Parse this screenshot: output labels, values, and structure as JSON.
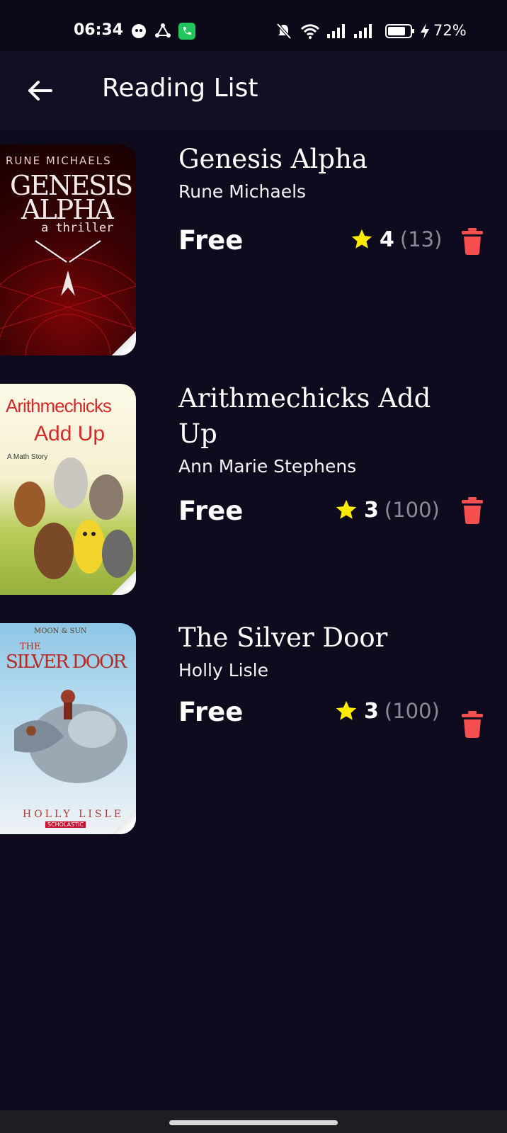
{
  "status_bar": {
    "time": "06:34",
    "battery": "72%"
  },
  "app_bar": {
    "title": "Reading List"
  },
  "books": [
    {
      "title": "Genesis Alpha",
      "author": "Rune Michaels",
      "price": "Free",
      "rating": "4",
      "rating_count": "(13)",
      "cover": {
        "author_text": "RUNE MICHAELS",
        "title_line1": "GENESIS",
        "title_line2": "ALPHA",
        "tagline": "a thriller"
      }
    },
    {
      "title": "Arithmechicks Add Up",
      "author": "Ann Marie Stephens",
      "price": "Free",
      "rating": "3",
      "rating_count": "(100)",
      "cover": {
        "title_line1": "Arithmechicks",
        "title_line2": "Add Up",
        "tagline": "A Math Story"
      }
    },
    {
      "title": "The Silver Door",
      "author": "Holly Lisle",
      "price": "Free",
      "rating": "3",
      "rating_count": "(100)",
      "cover": {
        "series": "MOON & SUN",
        "title_line1": "THE",
        "title_line2": "SILVER DOOR",
        "author_text": "HOLLY LISLE",
        "publisher": "SCHOLASTIC"
      }
    }
  ],
  "colors": {
    "background": "#0f0b1e",
    "app_bar": "#120e24",
    "star": "#ffeb00",
    "trash": "#f5504f"
  }
}
